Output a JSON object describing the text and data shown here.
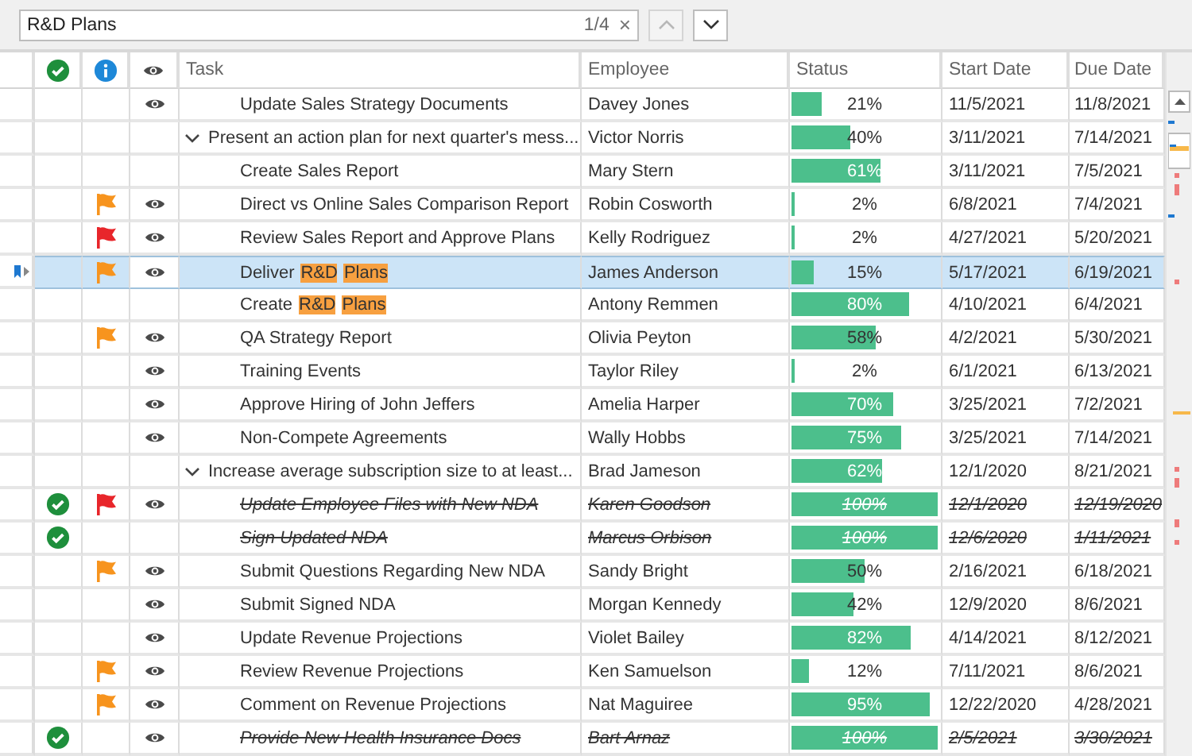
{
  "find_panel": {
    "query": "R&D Plans",
    "count": "1/4",
    "clear": "×",
    "prev_disabled": true,
    "next_disabled": false
  },
  "table": {
    "columns": [
      {
        "kind": "done"
      },
      {
        "kind": "flag"
      },
      {
        "kind": "watch"
      },
      {
        "kind": "text",
        "label": "Task"
      },
      {
        "kind": "text",
        "label": "Employee"
      },
      {
        "kind": "text",
        "label": "Status"
      },
      {
        "kind": "text",
        "label": "Start Date"
      },
      {
        "kind": "text",
        "label": "Due Date"
      }
    ],
    "rows": [
      {
        "kind": "task",
        "task": "Update Sales Strategy Documents",
        "employee": "Davey Jones",
        "level": 0.21,
        "status": "21%",
        "start": "11/5/2021",
        "due": "11/8/2021",
        "done": false,
        "watched": true,
        "completed": false,
        "selected": false
      },
      {
        "kind": "group",
        "task": "Present an action plan for next quarter's mess...",
        "employee": "Victor Norris",
        "level": 0.4,
        "status": "40%",
        "start": "3/11/2021",
        "due": "7/14/2021",
        "done": false,
        "watched": false,
        "completed": false,
        "selected": false,
        "expanded": true
      },
      {
        "kind": "task",
        "task": "Create Sales Report",
        "employee": "Mary Stern",
        "level": 0.61,
        "status": "61%",
        "start": "3/11/2021",
        "due": "7/5/2021",
        "done": false,
        "watched": false,
        "completed": false,
        "selected": false
      },
      {
        "kind": "task",
        "task": "Direct vs Online Sales Comparison Report",
        "employee": "Robin Cosworth",
        "level": 0.02,
        "status": "2%",
        "start": "6/8/2021",
        "due": "7/4/2021",
        "done": false,
        "flag": {
          "color": "#f7941e"
        },
        "watched": true,
        "completed": false,
        "selected": false
      },
      {
        "kind": "task",
        "task": "Review Sales Report and Approve Plans",
        "employee": "Kelly Rodriguez",
        "level": 0.02,
        "status": "2%",
        "start": "4/27/2021",
        "due": "5/20/2021",
        "done": false,
        "flag": {
          "color": "#e8262b"
        },
        "watched": true,
        "completed": false,
        "selected": false
      },
      {
        "kind": "task",
        "task_parts": [
          {
            "text": "Deliver",
            "match": false
          },
          {
            "text": "R&D",
            "match": true
          },
          {
            "text": "Plans",
            "match": true
          }
        ],
        "employee": "James Anderson",
        "level": 0.15,
        "status": "15%",
        "start": "5/17/2021",
        "due": "6/19/2021",
        "done": false,
        "flag": {
          "color": "#f7941e"
        },
        "watched": true,
        "completed": false,
        "selected": true
      },
      {
        "kind": "task",
        "task_parts": [
          {
            "text": "Create",
            "match": false
          },
          {
            "text": "R&D",
            "match": true
          },
          {
            "text": "Plans",
            "match": true
          }
        ],
        "employee": "Antony Remmen",
        "level": 0.8,
        "status": "80%",
        "start": "4/10/2021",
        "due": "6/4/2021",
        "done": false,
        "watched": false,
        "completed": false,
        "selected": false
      },
      {
        "kind": "task",
        "task": "QA Strategy Report",
        "employee": "Olivia Peyton",
        "level": 0.58,
        "status": "58%",
        "start": "4/2/2021",
        "due": "5/30/2021",
        "done": false,
        "flag": {
          "color": "#f7941e"
        },
        "watched": true,
        "completed": false,
        "selected": false
      },
      {
        "kind": "task",
        "task": "Training Events",
        "employee": "Taylor Riley",
        "level": 0.02,
        "status": "2%",
        "start": "6/1/2021",
        "due": "6/13/2021",
        "done": false,
        "watched": true,
        "completed": false,
        "selected": false
      },
      {
        "kind": "task",
        "task": "Approve Hiring of John Jeffers",
        "employee": "Amelia Harper",
        "level": 0.7,
        "status": "70%",
        "start": "3/25/2021",
        "due": "7/2/2021",
        "done": false,
        "watched": true,
        "completed": false,
        "selected": false
      },
      {
        "kind": "task",
        "task": "Non-Compete Agreements",
        "employee": "Wally Hobbs",
        "level": 0.75,
        "status": "75%",
        "start": "3/25/2021",
        "due": "7/14/2021",
        "done": false,
        "watched": true,
        "completed": false,
        "selected": false
      },
      {
        "kind": "group",
        "task": "Increase average subscription size to at least...",
        "employee": "Brad Jameson",
        "level": 0.62,
        "status": "62%",
        "start": "12/1/2020",
        "due": "8/21/2021",
        "done": false,
        "watched": false,
        "completed": false,
        "selected": false,
        "expanded": true
      },
      {
        "kind": "task",
        "task": "Update Employee Files with New NDA",
        "employee": "Karen Goodson",
        "level": 1,
        "status": "100%",
        "start": "12/1/2020",
        "due": "12/19/2020",
        "done": true,
        "flag": {
          "color": "#e8262b"
        },
        "watched": true,
        "completed": true,
        "selected": false
      },
      {
        "kind": "task",
        "task": "Sign Updated NDA",
        "employee": "Marcus Orbison",
        "level": 1,
        "status": "100%",
        "start": "12/6/2020",
        "due": "1/11/2021",
        "done": true,
        "watched": false,
        "completed": true,
        "selected": false
      },
      {
        "kind": "task",
        "task": "Submit Questions Regarding New NDA",
        "employee": "Sandy Bright",
        "level": 0.5,
        "status": "50%",
        "start": "2/16/2021",
        "due": "6/18/2021",
        "done": false,
        "flag": {
          "color": "#f7941e"
        },
        "watched": true,
        "completed": false,
        "selected": false
      },
      {
        "kind": "task",
        "task": "Submit Signed NDA",
        "employee": "Morgan Kennedy",
        "level": 0.42,
        "status": "42%",
        "start": "12/9/2020",
        "due": "8/6/2021",
        "done": false,
        "watched": true,
        "completed": false,
        "selected": false
      },
      {
        "kind": "task",
        "task": "Update Revenue Projections",
        "employee": "Violet Bailey",
        "level": 0.82,
        "status": "82%",
        "start": "4/14/2021",
        "due": "8/12/2021",
        "done": false,
        "watched": true,
        "completed": false,
        "selected": false
      },
      {
        "kind": "task",
        "task": "Review Revenue Projections",
        "employee": "Ken Samuelson",
        "level": 0.12,
        "status": "12%",
        "start": "7/11/2021",
        "due": "8/6/2021",
        "done": false,
        "flag": {
          "color": "#f7941e"
        },
        "watched": true,
        "completed": false,
        "selected": false
      },
      {
        "kind": "task",
        "task": "Comment on Revenue Projections",
        "employee": "Nat Maguiree",
        "level": 0.95,
        "status": "95%",
        "start": "12/22/2020",
        "due": "4/28/2021",
        "done": false,
        "flag": {
          "color": "#f7941e"
        },
        "watched": true,
        "completed": false,
        "selected": false
      },
      {
        "kind": "task",
        "task": "Provide New Health Insurance Docs",
        "employee": "Bart Arnaz",
        "level": 1,
        "status": "100%",
        "start": "2/5/2021",
        "due": "3/30/2021",
        "done": true,
        "watched": true,
        "completed": true,
        "selected": false
      }
    ]
  }
}
